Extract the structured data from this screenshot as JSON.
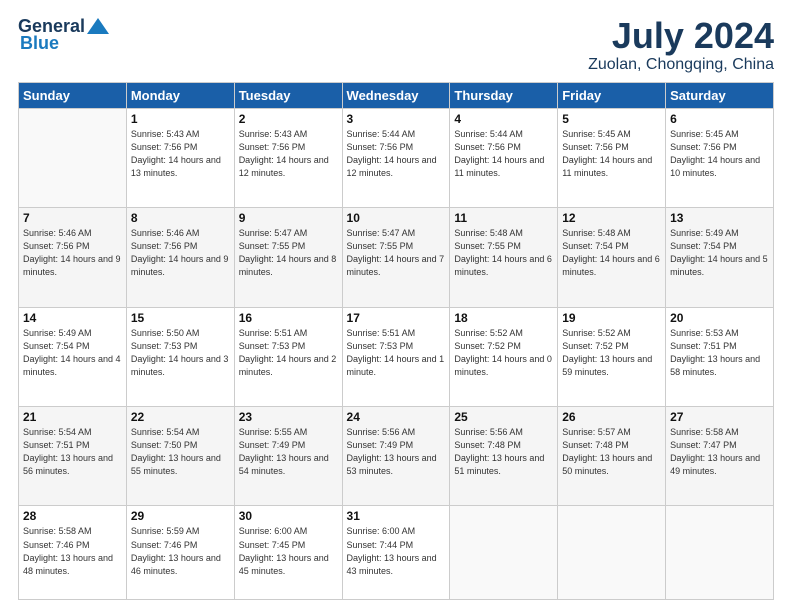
{
  "header": {
    "logo_line1": "General",
    "logo_line2": "Blue",
    "main_title": "July 2024",
    "subtitle": "Zuolan, Chongqing, China"
  },
  "days_of_week": [
    "Sunday",
    "Monday",
    "Tuesday",
    "Wednesday",
    "Thursday",
    "Friday",
    "Saturday"
  ],
  "weeks": [
    [
      {
        "day": "",
        "sunrise": "",
        "sunset": "",
        "daylight": ""
      },
      {
        "day": "1",
        "sunrise": "Sunrise: 5:43 AM",
        "sunset": "Sunset: 7:56 PM",
        "daylight": "Daylight: 14 hours and 13 minutes."
      },
      {
        "day": "2",
        "sunrise": "Sunrise: 5:43 AM",
        "sunset": "Sunset: 7:56 PM",
        "daylight": "Daylight: 14 hours and 12 minutes."
      },
      {
        "day": "3",
        "sunrise": "Sunrise: 5:44 AM",
        "sunset": "Sunset: 7:56 PM",
        "daylight": "Daylight: 14 hours and 12 minutes."
      },
      {
        "day": "4",
        "sunrise": "Sunrise: 5:44 AM",
        "sunset": "Sunset: 7:56 PM",
        "daylight": "Daylight: 14 hours and 11 minutes."
      },
      {
        "day": "5",
        "sunrise": "Sunrise: 5:45 AM",
        "sunset": "Sunset: 7:56 PM",
        "daylight": "Daylight: 14 hours and 11 minutes."
      },
      {
        "day": "6",
        "sunrise": "Sunrise: 5:45 AM",
        "sunset": "Sunset: 7:56 PM",
        "daylight": "Daylight: 14 hours and 10 minutes."
      }
    ],
    [
      {
        "day": "7",
        "sunrise": "Sunrise: 5:46 AM",
        "sunset": "Sunset: 7:56 PM",
        "daylight": "Daylight: 14 hours and 9 minutes."
      },
      {
        "day": "8",
        "sunrise": "Sunrise: 5:46 AM",
        "sunset": "Sunset: 7:56 PM",
        "daylight": "Daylight: 14 hours and 9 minutes."
      },
      {
        "day": "9",
        "sunrise": "Sunrise: 5:47 AM",
        "sunset": "Sunset: 7:55 PM",
        "daylight": "Daylight: 14 hours and 8 minutes."
      },
      {
        "day": "10",
        "sunrise": "Sunrise: 5:47 AM",
        "sunset": "Sunset: 7:55 PM",
        "daylight": "Daylight: 14 hours and 7 minutes."
      },
      {
        "day": "11",
        "sunrise": "Sunrise: 5:48 AM",
        "sunset": "Sunset: 7:55 PM",
        "daylight": "Daylight: 14 hours and 6 minutes."
      },
      {
        "day": "12",
        "sunrise": "Sunrise: 5:48 AM",
        "sunset": "Sunset: 7:54 PM",
        "daylight": "Daylight: 14 hours and 6 minutes."
      },
      {
        "day": "13",
        "sunrise": "Sunrise: 5:49 AM",
        "sunset": "Sunset: 7:54 PM",
        "daylight": "Daylight: 14 hours and 5 minutes."
      }
    ],
    [
      {
        "day": "14",
        "sunrise": "Sunrise: 5:49 AM",
        "sunset": "Sunset: 7:54 PM",
        "daylight": "Daylight: 14 hours and 4 minutes."
      },
      {
        "day": "15",
        "sunrise": "Sunrise: 5:50 AM",
        "sunset": "Sunset: 7:53 PM",
        "daylight": "Daylight: 14 hours and 3 minutes."
      },
      {
        "day": "16",
        "sunrise": "Sunrise: 5:51 AM",
        "sunset": "Sunset: 7:53 PM",
        "daylight": "Daylight: 14 hours and 2 minutes."
      },
      {
        "day": "17",
        "sunrise": "Sunrise: 5:51 AM",
        "sunset": "Sunset: 7:53 PM",
        "daylight": "Daylight: 14 hours and 1 minute."
      },
      {
        "day": "18",
        "sunrise": "Sunrise: 5:52 AM",
        "sunset": "Sunset: 7:52 PM",
        "daylight": "Daylight: 14 hours and 0 minutes."
      },
      {
        "day": "19",
        "sunrise": "Sunrise: 5:52 AM",
        "sunset": "Sunset: 7:52 PM",
        "daylight": "Daylight: 13 hours and 59 minutes."
      },
      {
        "day": "20",
        "sunrise": "Sunrise: 5:53 AM",
        "sunset": "Sunset: 7:51 PM",
        "daylight": "Daylight: 13 hours and 58 minutes."
      }
    ],
    [
      {
        "day": "21",
        "sunrise": "Sunrise: 5:54 AM",
        "sunset": "Sunset: 7:51 PM",
        "daylight": "Daylight: 13 hours and 56 minutes."
      },
      {
        "day": "22",
        "sunrise": "Sunrise: 5:54 AM",
        "sunset": "Sunset: 7:50 PM",
        "daylight": "Daylight: 13 hours and 55 minutes."
      },
      {
        "day": "23",
        "sunrise": "Sunrise: 5:55 AM",
        "sunset": "Sunset: 7:49 PM",
        "daylight": "Daylight: 13 hours and 54 minutes."
      },
      {
        "day": "24",
        "sunrise": "Sunrise: 5:56 AM",
        "sunset": "Sunset: 7:49 PM",
        "daylight": "Daylight: 13 hours and 53 minutes."
      },
      {
        "day": "25",
        "sunrise": "Sunrise: 5:56 AM",
        "sunset": "Sunset: 7:48 PM",
        "daylight": "Daylight: 13 hours and 51 minutes."
      },
      {
        "day": "26",
        "sunrise": "Sunrise: 5:57 AM",
        "sunset": "Sunset: 7:48 PM",
        "daylight": "Daylight: 13 hours and 50 minutes."
      },
      {
        "day": "27",
        "sunrise": "Sunrise: 5:58 AM",
        "sunset": "Sunset: 7:47 PM",
        "daylight": "Daylight: 13 hours and 49 minutes."
      }
    ],
    [
      {
        "day": "28",
        "sunrise": "Sunrise: 5:58 AM",
        "sunset": "Sunset: 7:46 PM",
        "daylight": "Daylight: 13 hours and 48 minutes."
      },
      {
        "day": "29",
        "sunrise": "Sunrise: 5:59 AM",
        "sunset": "Sunset: 7:46 PM",
        "daylight": "Daylight: 13 hours and 46 minutes."
      },
      {
        "day": "30",
        "sunrise": "Sunrise: 6:00 AM",
        "sunset": "Sunset: 7:45 PM",
        "daylight": "Daylight: 13 hours and 45 minutes."
      },
      {
        "day": "31",
        "sunrise": "Sunrise: 6:00 AM",
        "sunset": "Sunset: 7:44 PM",
        "daylight": "Daylight: 13 hours and 43 minutes."
      },
      {
        "day": "",
        "sunrise": "",
        "sunset": "",
        "daylight": ""
      },
      {
        "day": "",
        "sunrise": "",
        "sunset": "",
        "daylight": ""
      },
      {
        "day": "",
        "sunrise": "",
        "sunset": "",
        "daylight": ""
      }
    ]
  ]
}
